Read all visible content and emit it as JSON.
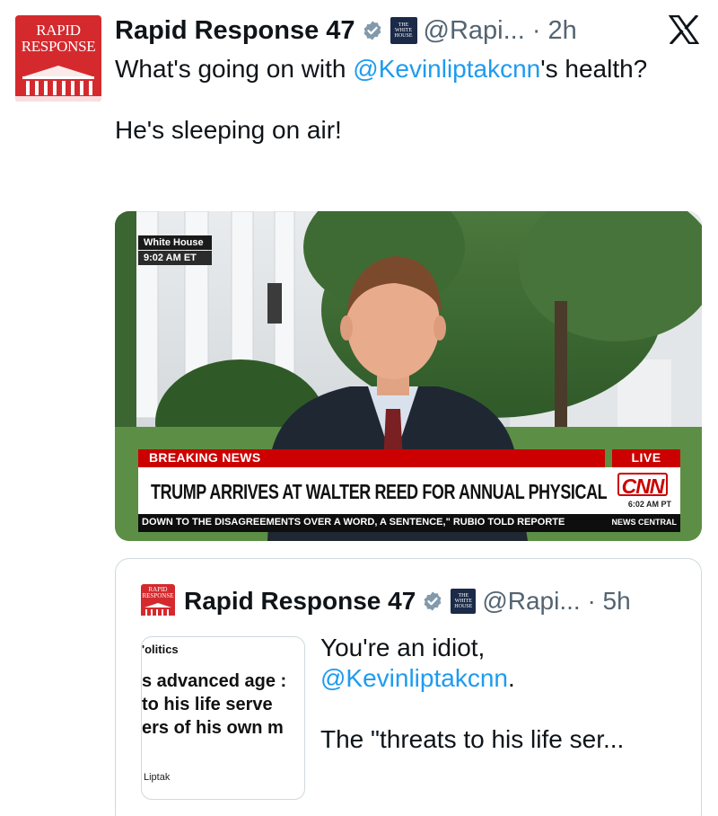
{
  "tweet": {
    "author_name": "Rapid Response 47",
    "handle_time": "@Rapi... · 2h",
    "avatar_text": "RAPID\nRESPONSE",
    "affiliate_badge_text": "THE WHITE HOUSE",
    "text_line1_pre": "What's going on with ",
    "text_mention": "@Kevinliptakcnn",
    "text_line1_post": "'s health?",
    "text_para2": "He's sleeping on air!"
  },
  "media": {
    "location_bug": "White House",
    "time_bug": "9:02 AM ET",
    "breaking_label": "BREAKING NEWS",
    "live_label": "LIVE",
    "headline": "TRUMP ARRIVES AT WALTER REED FOR ANNUAL PHYSICAL",
    "network_logo": "CNN",
    "local_time": "6:02 AM PT",
    "ticker_text": "DOWN TO THE DISAGREEMENTS OVER A WORD, A SENTENCE,\" RUBIO TOLD REPORTE",
    "ticker_source": "NEWS CENTRAL"
  },
  "quote": {
    "author_name": "Rapid Response 47",
    "handle_time": "@Rapi... · 5h",
    "thumb_category": "'olitics",
    "thumb_line1": "s advanced age :",
    "thumb_line2": " to his life serve",
    "thumb_line3": "ers of his own m",
    "thumb_byline": "Liptak",
    "text_line1": "You're an idiot,",
    "text_mention": "@Kevinliptakcnn",
    "text_after_mention": ".",
    "text_para2": "The \"threats to his life ser..."
  },
  "icons": {
    "verified": "verified-check-icon",
    "x_logo": "x-logo-icon"
  },
  "colors": {
    "mention": "#1d9bf0",
    "avatar_red": "#d42a2e",
    "cnn_red": "#cc0000",
    "verified_gray": "#829aab"
  }
}
